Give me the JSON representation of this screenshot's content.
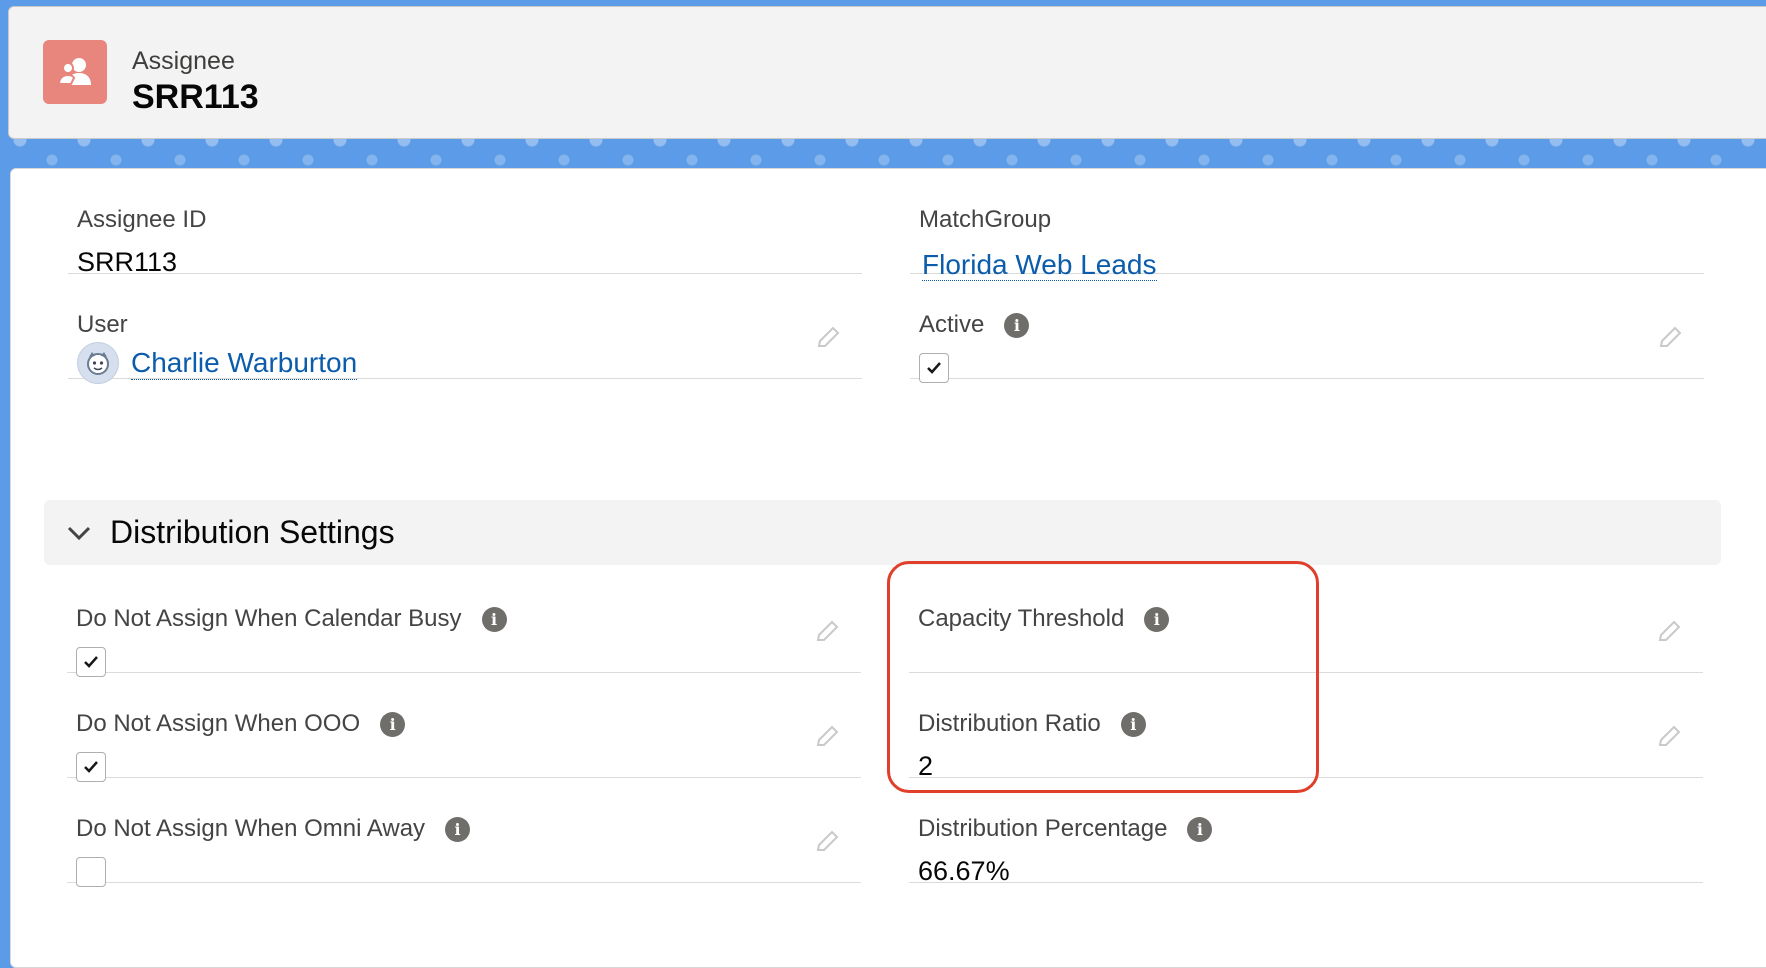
{
  "header": {
    "object_label": "Assignee",
    "record_name": "SRR113",
    "icon": "assignee-icon"
  },
  "details": {
    "assignee_id": {
      "label": "Assignee ID",
      "value": "SRR113"
    },
    "match_group": {
      "label": "MatchGroup",
      "value": "Florida Web Leads"
    },
    "user": {
      "label": "User",
      "value": "Charlie Warburton"
    },
    "active": {
      "label": "Active",
      "checked": true
    }
  },
  "distribution": {
    "section_title": "Distribution Settings",
    "calendar_busy": {
      "label": "Do Not Assign When Calendar Busy",
      "checked": true
    },
    "ooo": {
      "label": "Do Not Assign When OOO",
      "checked": true
    },
    "omni_away": {
      "label": "Do Not Assign When Omni Away",
      "checked": false
    },
    "capacity_threshold": {
      "label": "Capacity Threshold",
      "value": ""
    },
    "distribution_ratio": {
      "label": "Distribution Ratio",
      "value": "2"
    },
    "distribution_percentage": {
      "label": "Distribution Percentage",
      "value": "66.67%"
    }
  },
  "colors": {
    "link": "#0b5cab",
    "header_icon_bg": "#e8857d",
    "highlight": "#e0402b"
  }
}
